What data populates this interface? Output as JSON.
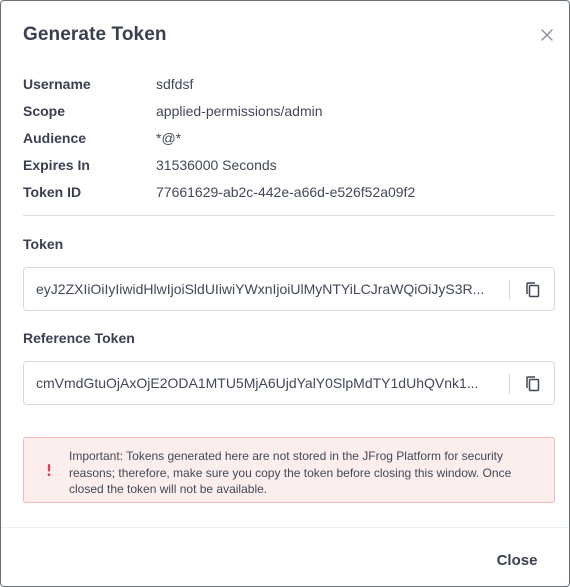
{
  "dialog": {
    "title": "Generate Token",
    "close_icon": "close-icon"
  },
  "info": [
    {
      "label": "Username",
      "value": "sdfdsf"
    },
    {
      "label": "Scope",
      "value": "applied-permissions/admin"
    },
    {
      "label": "Audience",
      "value": "*@*"
    },
    {
      "label": "Expires In",
      "value": "31536000 Seconds"
    },
    {
      "label": "Token ID",
      "value": "77661629-ab2c-442e-a66d-e526f52a09f2"
    }
  ],
  "token": {
    "label": "Token",
    "value": "eyJ2ZXIiOiIyIiwidHlwIjoiSldUIiwiYWxnIjoiUlMyNTYiLCJraWQiOiJyS3R...",
    "copy_icon": "copy-icon"
  },
  "reference_token": {
    "label": "Reference Token",
    "value": "cmVmdGtuOjAxOjE2ODA1MTU5MjA6UjdYalY0SlpMdTY1dUhQVnk1...",
    "copy_icon": "copy-icon"
  },
  "alert": {
    "icon": "exclamation-icon",
    "text": "Important: Tokens generated here are not stored in the JFrog Platform for security reasons; therefore, make sure you copy the token before closing this window. Once closed the token will not be available."
  },
  "footer": {
    "close_label": "Close"
  },
  "colors": {
    "text": "#414857",
    "heading": "#3a4050",
    "border": "#d7dae0",
    "alert_bg": "#fdeeee",
    "alert_border": "#f3b9b9",
    "alert_icon": "#e0424f"
  }
}
